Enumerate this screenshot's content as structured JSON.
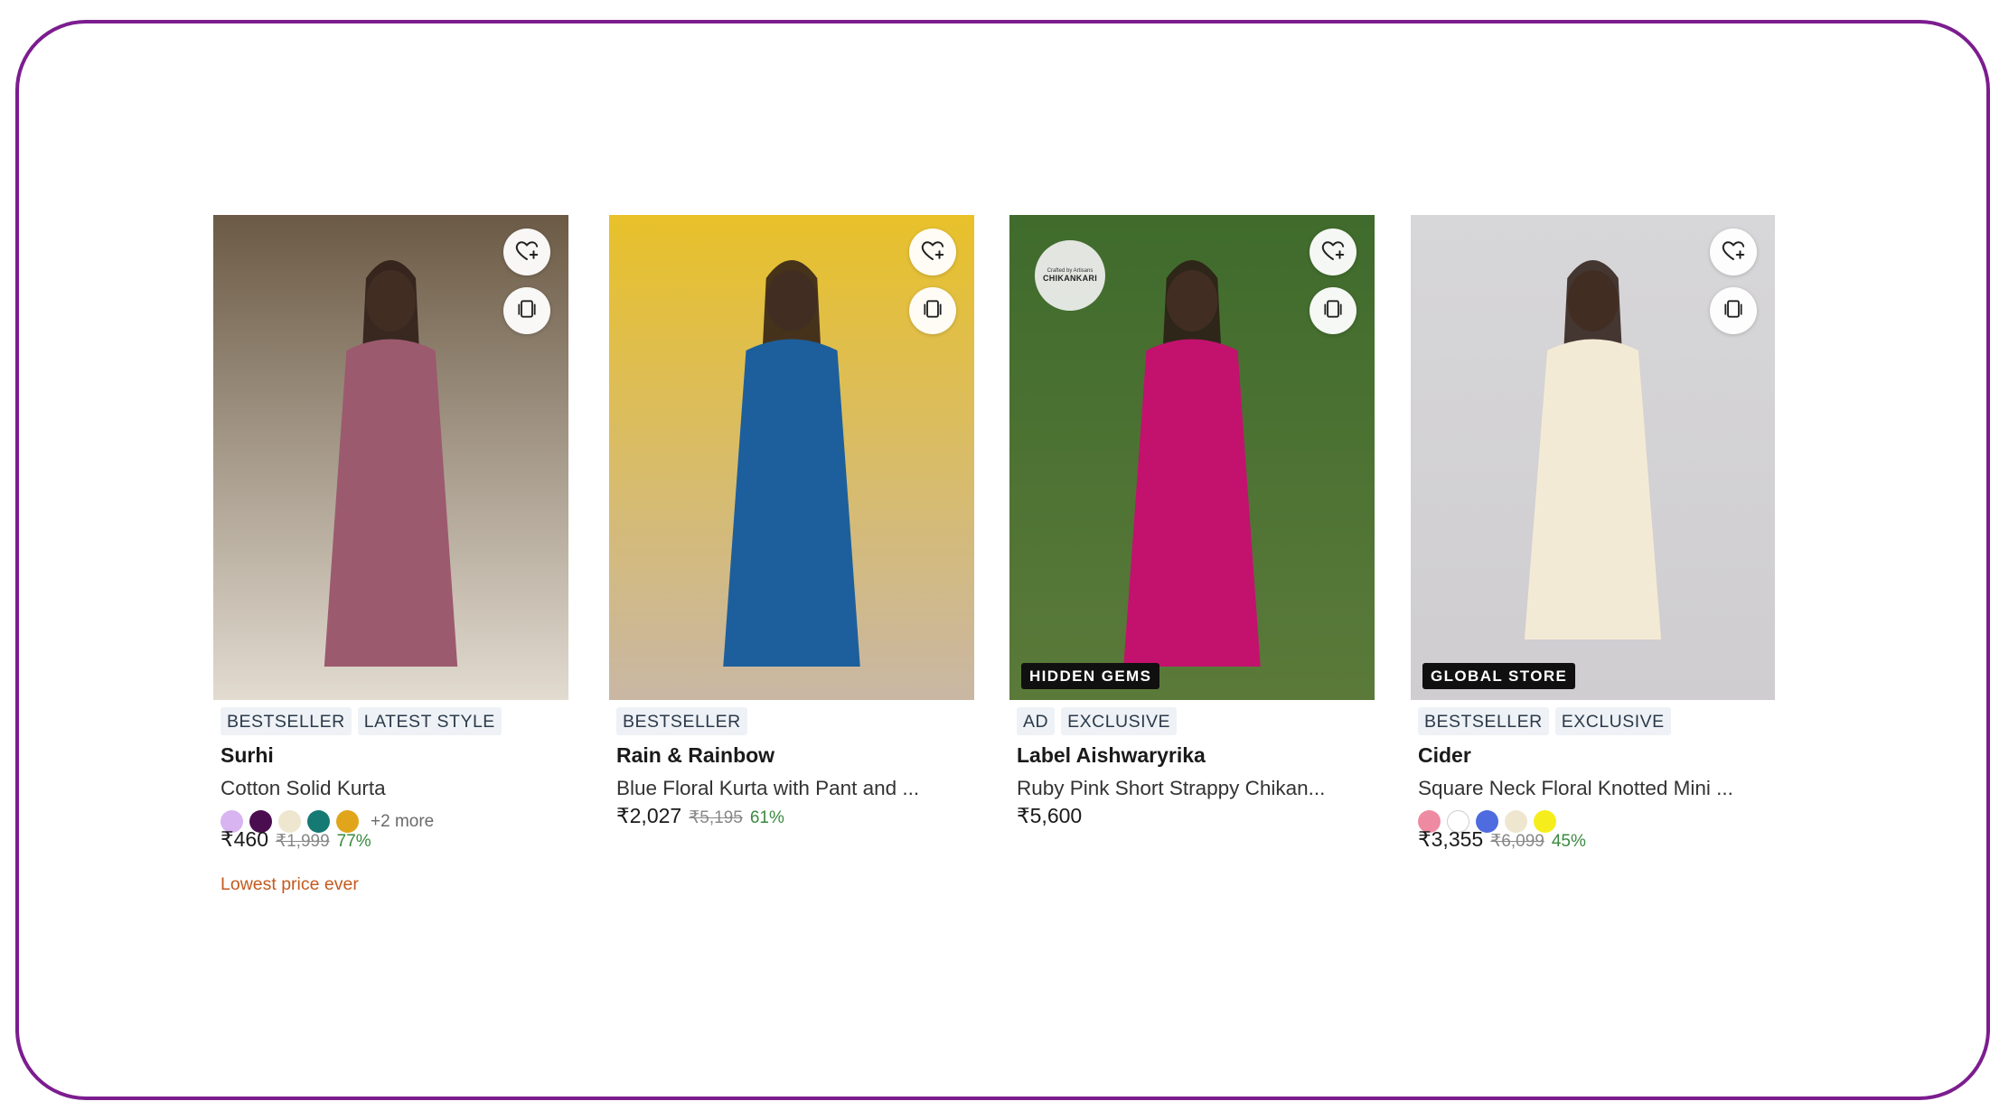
{
  "products": [
    {
      "tags": [
        "BESTSELLER",
        "LATEST STYLE"
      ],
      "brand": "Surhi",
      "name": "Cotton Solid Kurta",
      "swatches": [
        "#d8b4f0",
        "#4a0d4f",
        "#efe6cf",
        "#157a74",
        "#e0a51b"
      ],
      "more_colors": "+2 more",
      "price": "₹460",
      "mrp": "₹1,999",
      "discount": "77%",
      "note": "Lowest price ever",
      "overlay_label": "",
      "colors": {
        "top": "#6b5a45",
        "bottom": "#e2dbd0",
        "garment": "#9c5a6e"
      }
    },
    {
      "tags": [
        "BESTSELLER"
      ],
      "brand": "Rain & Rainbow",
      "name": "Blue Floral Kurta with Pant and ...",
      "swatches": [],
      "more_colors": "",
      "price": "₹2,027",
      "mrp": "₹5,195",
      "discount": "61%",
      "note": "",
      "overlay_label": "",
      "colors": {
        "top": "#e8c12a",
        "bottom": "#c9b7a4",
        "garment": "#1d5f9c"
      }
    },
    {
      "tags": [
        "AD",
        "EXCLUSIVE"
      ],
      "brand": "Label Aishwaryrika",
      "name": "Ruby Pink Short Strappy Chikan...",
      "swatches": [],
      "more_colors": "",
      "price": "₹5,600",
      "mrp": "",
      "discount": "",
      "note": "",
      "overlay_label": "HIDDEN GEMS",
      "seal_small": "Crafted by Artisans",
      "seal_big": "CHIKANKARI",
      "colors": {
        "top": "#3f6b2c",
        "bottom": "#5b7a3a",
        "garment": "#c2126e"
      }
    },
    {
      "tags": [
        "BESTSELLER",
        "EXCLUSIVE"
      ],
      "brand": "Cider",
      "name": "Square Neck Floral Knotted Mini ...",
      "swatches": [
        "#ee8aa2",
        "#ffffff",
        "#4f6be0",
        "#efe6cf",
        "#f5ee1c"
      ],
      "more_colors": "",
      "price": "₹3,355",
      "mrp": "₹6,099",
      "discount": "45%",
      "note": "",
      "overlay_label": "GLOBAL STORE",
      "colors": {
        "top": "#d7d6d8",
        "bottom": "#cfcdcf",
        "garment": "#f3ead6"
      }
    }
  ]
}
